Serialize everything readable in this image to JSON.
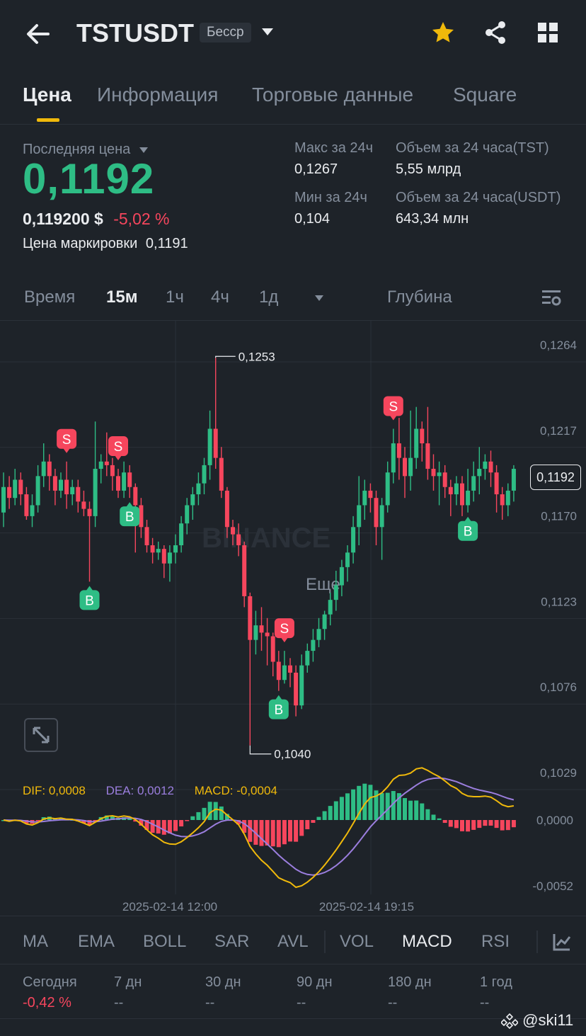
{
  "header": {
    "symbol": "TSTUSDT",
    "contract_tag": "Бесср",
    "icons": [
      "back-arrow-icon",
      "chevron-down-icon",
      "star-icon",
      "share-icon",
      "grid-icon"
    ],
    "accent_color": "#f0b90b"
  },
  "tabs": [
    "Цена",
    "Информация",
    "Торговые данные",
    "Square"
  ],
  "price_block": {
    "last_price_label": "Последняя цена",
    "last_price": "0,1192",
    "usd_price": "0,119200 $",
    "change_pct": "-5,02 %",
    "mark_price_label": "Цена маркировки",
    "mark_price": "0,1191",
    "high_label": "Макс за 24ч",
    "high_value": "0,1267",
    "low_label": "Мин за 24ч",
    "low_value": "0,104",
    "vol_tst_label": "Объем за 24 часа(TST)",
    "vol_tst_value": "5,55 млрд",
    "vol_usdt_label": "Объем за 24 часа(USDT)",
    "vol_usdt_value": "643,34 млн",
    "up_color": "#2ebd85",
    "down_color": "#f6465d"
  },
  "periods": {
    "time": "Время",
    "p15m": "15м",
    "p1h": "1ч",
    "p4h": "4ч",
    "p1d": "1д",
    "more": "Еще",
    "depth": "Глубина"
  },
  "chart_data": {
    "type": "candlestick",
    "y_ticks": [
      "0,1264",
      "0,1217",
      "0,1170",
      "0,1123",
      "0,1076",
      "0,1029"
    ],
    "current_price_tag": "0,1192",
    "high_annotation": "0,1253",
    "low_annotation": "0,1040",
    "x_ticks": [
      "2025-02-14 12:00",
      "2025-02-14 19:15"
    ],
    "watermark": "BINANCE",
    "trade_markers": [
      "S",
      "S",
      "B",
      "B",
      "S",
      "B",
      "S",
      "B"
    ],
    "candles": [
      [
        0.1168,
        0.1182,
        0.116,
        0.119
      ],
      [
        0.1182,
        0.1176,
        0.117,
        0.1188
      ],
      [
        0.1176,
        0.1186,
        0.1172,
        0.1192
      ],
      [
        0.1186,
        0.1178,
        0.1172,
        0.119
      ],
      [
        0.1178,
        0.1166,
        0.1164,
        0.1182
      ],
      [
        0.1166,
        0.1172,
        0.116,
        0.1178
      ],
      [
        0.1172,
        0.1188,
        0.1168,
        0.1194
      ],
      [
        0.1188,
        0.1196,
        0.1182,
        0.1206
      ],
      [
        0.1196,
        0.1188,
        0.118,
        0.12
      ],
      [
        0.1188,
        0.118,
        0.1172,
        0.1192
      ],
      [
        0.118,
        0.1186,
        0.1176,
        0.119
      ],
      [
        0.1186,
        0.1178,
        0.117,
        0.1196
      ],
      [
        0.1178,
        0.1182,
        0.1172,
        0.1186
      ],
      [
        0.1182,
        0.1174,
        0.1168,
        0.1186
      ],
      [
        0.1174,
        0.117,
        0.1166,
        0.118
      ],
      [
        0.117,
        0.1166,
        0.113,
        0.1174
      ],
      [
        0.1166,
        0.1192,
        0.116,
        0.1218
      ],
      [
        0.1192,
        0.1196,
        0.1184,
        0.12
      ],
      [
        0.1196,
        0.1194,
        0.1188,
        0.1212
      ],
      [
        0.1194,
        0.1188,
        0.118,
        0.1198
      ],
      [
        0.1188,
        0.118,
        0.1176,
        0.1192
      ],
      [
        0.118,
        0.119,
        0.1176,
        0.1196
      ],
      [
        0.119,
        0.1182,
        0.1176,
        0.1194
      ],
      [
        0.1182,
        0.1172,
        0.1146,
        0.1184
      ],
      [
        0.1172,
        0.116,
        0.1154,
        0.1176
      ],
      [
        0.116,
        0.115,
        0.1146,
        0.1164
      ],
      [
        0.115,
        0.1146,
        0.114,
        0.1154
      ],
      [
        0.1146,
        0.1148,
        0.1142,
        0.1152
      ],
      [
        0.1148,
        0.114,
        0.1132,
        0.115
      ],
      [
        0.114,
        0.1146,
        0.113,
        0.115
      ],
      [
        0.1146,
        0.115,
        0.114,
        0.1156
      ],
      [
        0.115,
        0.1162,
        0.1146,
        0.1166
      ],
      [
        0.1162,
        0.1172,
        0.1156,
        0.1176
      ],
      [
        0.1172,
        0.1178,
        0.1164,
        0.1182
      ],
      [
        0.1178,
        0.1184,
        0.1172,
        0.119
      ],
      [
        0.1184,
        0.1194,
        0.1178,
        0.1198
      ],
      [
        0.1194,
        0.1214,
        0.1186,
        0.1224
      ],
      [
        0.1214,
        0.1198,
        0.1192,
        0.1253
      ],
      [
        0.1198,
        0.118,
        0.1176,
        0.1204
      ],
      [
        0.118,
        0.116,
        0.1154,
        0.1182
      ],
      [
        0.116,
        0.1156,
        0.115,
        0.1164
      ],
      [
        0.1156,
        0.115,
        0.1144,
        0.1162
      ],
      [
        0.115,
        0.1122,
        0.1116,
        0.1152
      ],
      [
        0.1122,
        0.1098,
        0.104,
        0.1124
      ],
      [
        0.1098,
        0.1106,
        0.109,
        0.1114
      ],
      [
        0.1106,
        0.1102,
        0.1092,
        0.1116
      ],
      [
        0.1102,
        0.11,
        0.1084,
        0.111
      ],
      [
        0.11,
        0.1086,
        0.1078,
        0.1102
      ],
      [
        0.1086,
        0.1076,
        0.107,
        0.1092
      ],
      [
        0.1076,
        0.1084,
        0.1074,
        0.1092
      ],
      [
        0.1084,
        0.108,
        0.1072,
        0.1088
      ],
      [
        0.108,
        0.1062,
        0.1056,
        0.1084
      ],
      [
        0.1062,
        0.1084,
        0.106,
        0.109
      ],
      [
        0.1084,
        0.1092,
        0.108,
        0.1096
      ],
      [
        0.1092,
        0.1098,
        0.1086,
        0.1104
      ],
      [
        0.1098,
        0.1104,
        0.1094,
        0.111
      ],
      [
        0.1104,
        0.1112,
        0.1098,
        0.1114
      ],
      [
        0.1112,
        0.112,
        0.1106,
        0.1124
      ],
      [
        0.112,
        0.1128,
        0.1114,
        0.1136
      ],
      [
        0.1128,
        0.1138,
        0.1122,
        0.1142
      ],
      [
        0.1138,
        0.1146,
        0.113,
        0.115
      ],
      [
        0.1146,
        0.116,
        0.114,
        0.1166
      ],
      [
        0.116,
        0.1172,
        0.115,
        0.1188
      ],
      [
        0.1172,
        0.118,
        0.1164,
        0.1186
      ],
      [
        0.118,
        0.1176,
        0.1168,
        0.1184
      ],
      [
        0.1176,
        0.116,
        0.115,
        0.118
      ],
      [
        0.116,
        0.1172,
        0.1142,
        0.1176
      ],
      [
        0.1172,
        0.119,
        0.1168,
        0.1196
      ],
      [
        0.119,
        0.1206,
        0.1184,
        0.1214
      ],
      [
        0.1206,
        0.1198,
        0.1186,
        0.122
      ],
      [
        0.1198,
        0.1188,
        0.1176,
        0.1204
      ],
      [
        0.1188,
        0.1198,
        0.118,
        0.1224
      ],
      [
        0.1198,
        0.1214,
        0.1192,
        0.1226
      ],
      [
        0.1214,
        0.1206,
        0.1196,
        0.1218
      ],
      [
        0.1206,
        0.1192,
        0.1186,
        0.1226
      ],
      [
        0.1192,
        0.1188,
        0.118,
        0.12
      ],
      [
        0.1188,
        0.119,
        0.1172,
        0.1196
      ],
      [
        0.119,
        0.1182,
        0.1176,
        0.1194
      ],
      [
        0.1182,
        0.1178,
        0.1166,
        0.1186
      ],
      [
        0.1178,
        0.1184,
        0.1172,
        0.1188
      ],
      [
        0.1184,
        0.1172,
        0.1166,
        0.1188
      ],
      [
        0.1172,
        0.118,
        0.1168,
        0.1192
      ],
      [
        0.118,
        0.1188,
        0.1174,
        0.1196
      ],
      [
        0.1188,
        0.1192,
        0.1178,
        0.1204
      ],
      [
        0.1192,
        0.1196,
        0.1186,
        0.12
      ],
      [
        0.1196,
        0.119,
        0.1182,
        0.1202
      ],
      [
        0.119,
        0.1178,
        0.1168,
        0.1194
      ],
      [
        0.1178,
        0.1172,
        0.1164,
        0.1182
      ],
      [
        0.1172,
        0.118,
        0.1166,
        0.1184
      ],
      [
        0.118,
        0.1192,
        0.1174,
        0.1194
      ]
    ]
  },
  "macd": {
    "dif_label": "DIF: 0,0008",
    "dea_label": "DEA: 0,0012",
    "macd_label": "MACD: -0,0004",
    "y_top": "0,0000",
    "y_bottom": "-0,0052",
    "dif_color": "#f0b90b",
    "dea_color": "#9b7ede"
  },
  "indicators": [
    "MA",
    "EMA",
    "BOLL",
    "SAR",
    "AVL",
    "VOL",
    "MACD",
    "RSI"
  ],
  "stats": [
    {
      "label": "Сегодня",
      "value": "-0,42 %"
    },
    {
      "label": "7 дн",
      "value": "--"
    },
    {
      "label": "30 дн",
      "value": "--"
    },
    {
      "label": "90 дн",
      "value": "--"
    },
    {
      "label": "180 дн",
      "value": "--"
    },
    {
      "label": "1 год",
      "value": "--"
    }
  ],
  "footer_watermark": "@ski11"
}
